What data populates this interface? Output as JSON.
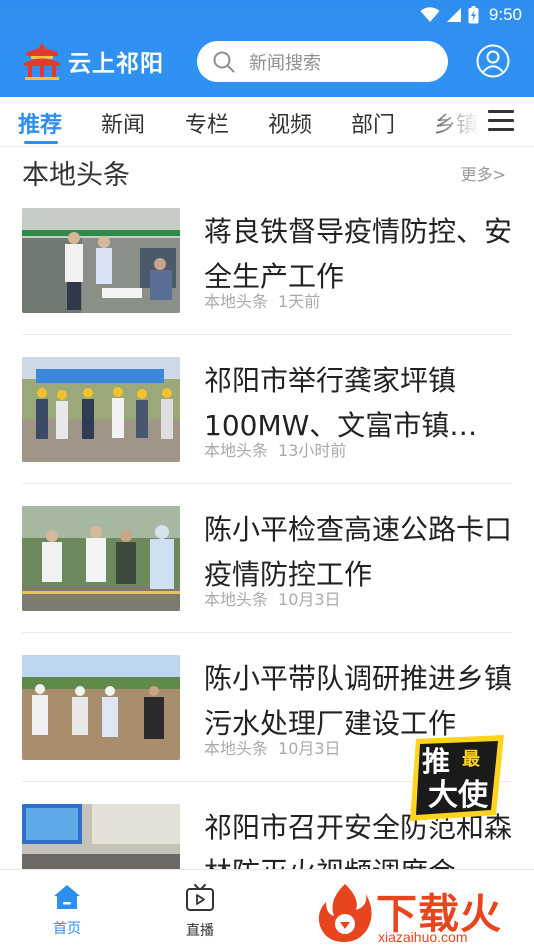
{
  "status_bar": {
    "time": "9:50"
  },
  "header": {
    "app_name": "云上祁阳",
    "search_placeholder": "新闻搜索"
  },
  "tabs": [
    {
      "label": "推荐",
      "active": true
    },
    {
      "label": "新闻"
    },
    {
      "label": "专栏"
    },
    {
      "label": "视频"
    },
    {
      "label": "部门"
    },
    {
      "label": "乡镇"
    }
  ],
  "section": {
    "title": "本地头条",
    "more": "更多>"
  },
  "news": [
    {
      "title": "蒋良铁督导疫情防控、安全生产工作",
      "source": "本地头条",
      "time": "1天前"
    },
    {
      "title": "祁阳市举行龚家坪镇100MW、文富市镇…",
      "source": "本地头条",
      "time": "13小时前"
    },
    {
      "title": "陈小平检查高速公路卡口疫情防控工作",
      "source": "本地头条",
      "time": "10月3日"
    },
    {
      "title": "陈小平带队调研推进乡镇污水处理厂建设工作",
      "source": "本地头条",
      "time": "10月3日"
    },
    {
      "title": "祁阳市召开安全防范和森林防灭火视频调度会",
      "source": "",
      "time": ""
    }
  ],
  "bottom_nav": [
    {
      "label": "首页",
      "active": true
    },
    {
      "label": "直播"
    }
  ],
  "overlays": {
    "badge_text_1": "推",
    "badge_text_2": "最",
    "badge_text_3": "大使",
    "watermark_text": "下载火",
    "watermark_url": "xiazaihuo.com"
  },
  "colors": {
    "brand_blue": "#2f8ff0",
    "watermark_red": "#e8451f"
  }
}
